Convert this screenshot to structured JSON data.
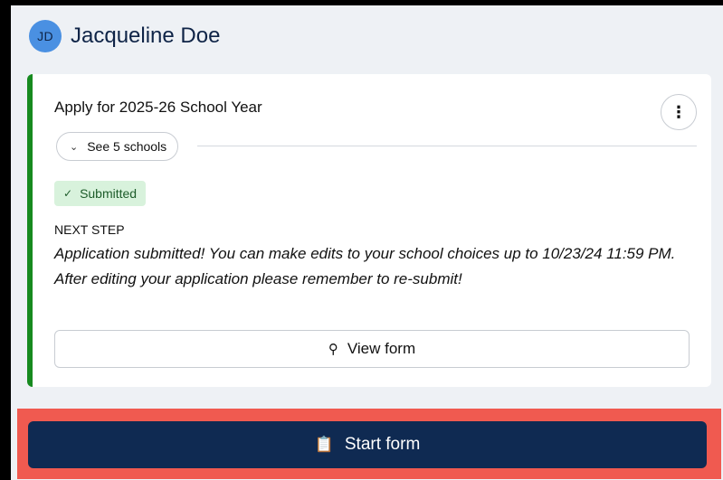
{
  "user": {
    "initials": "JD",
    "name": "Jacqueline Doe"
  },
  "application": {
    "title": "Apply for 2025-26 School Year",
    "schools_toggle_label": "See 5 schools",
    "status": "Submitted",
    "next_step_label": "NEXT STEP",
    "next_step_text": "Application submitted! You can make edits to your school choices up to 10/23/24 11:59 PM. After editing your application please remember to re-submit!",
    "view_form_label": "View form",
    "kebab_icon": "⋮"
  },
  "actions": {
    "start_form_label": "Start form"
  },
  "colors": {
    "accent": "#168a1f",
    "primary": "#0f2a52",
    "highlight": "#f05a50",
    "status_bg": "#d8f2dc"
  }
}
